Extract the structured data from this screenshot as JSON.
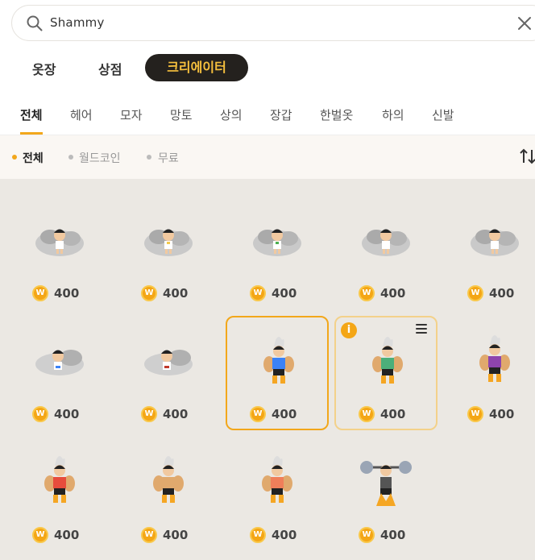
{
  "search": {
    "value": "Shammy"
  },
  "main_tabs": [
    {
      "label": "옷장"
    },
    {
      "label": "상점"
    },
    {
      "label": "크리에이터"
    }
  ],
  "categories": [
    "전체",
    "헤어",
    "모자",
    "망토",
    "상의",
    "장갑",
    "한벌옷",
    "하의",
    "신발"
  ],
  "filters": [
    "전체",
    "월드코인",
    "무료"
  ],
  "items": [
    {
      "price": "400",
      "sprite": "smoke-character"
    },
    {
      "price": "400",
      "sprite": "smoke-character"
    },
    {
      "price": "400",
      "sprite": "smoke-character"
    },
    {
      "price": "400",
      "sprite": "smoke-character"
    },
    {
      "price": "400",
      "sprite": "smoke-character"
    },
    {
      "price": "400",
      "sprite": "smoke-character"
    },
    {
      "price": "400",
      "sprite": "smoke-character"
    },
    {
      "price": "400",
      "sprite": "muscle-character-blue"
    },
    {
      "price": "400",
      "sprite": "muscle-character-green"
    },
    {
      "price": "400",
      "sprite": "muscle-character-purple"
    },
    {
      "price": "400",
      "sprite": "muscle-character-red"
    },
    {
      "price": "400",
      "sprite": "muscle-character-tan"
    },
    {
      "price": "400",
      "sprite": "muscle-character-orange"
    },
    {
      "price": "400",
      "sprite": "weightlifter-character"
    }
  ],
  "coin_symbol": "W",
  "info_symbol": "i",
  "colors": {
    "accent": "#f2a71b",
    "dark_pill": "#24211e",
    "pill_text": "#f6c03d"
  }
}
